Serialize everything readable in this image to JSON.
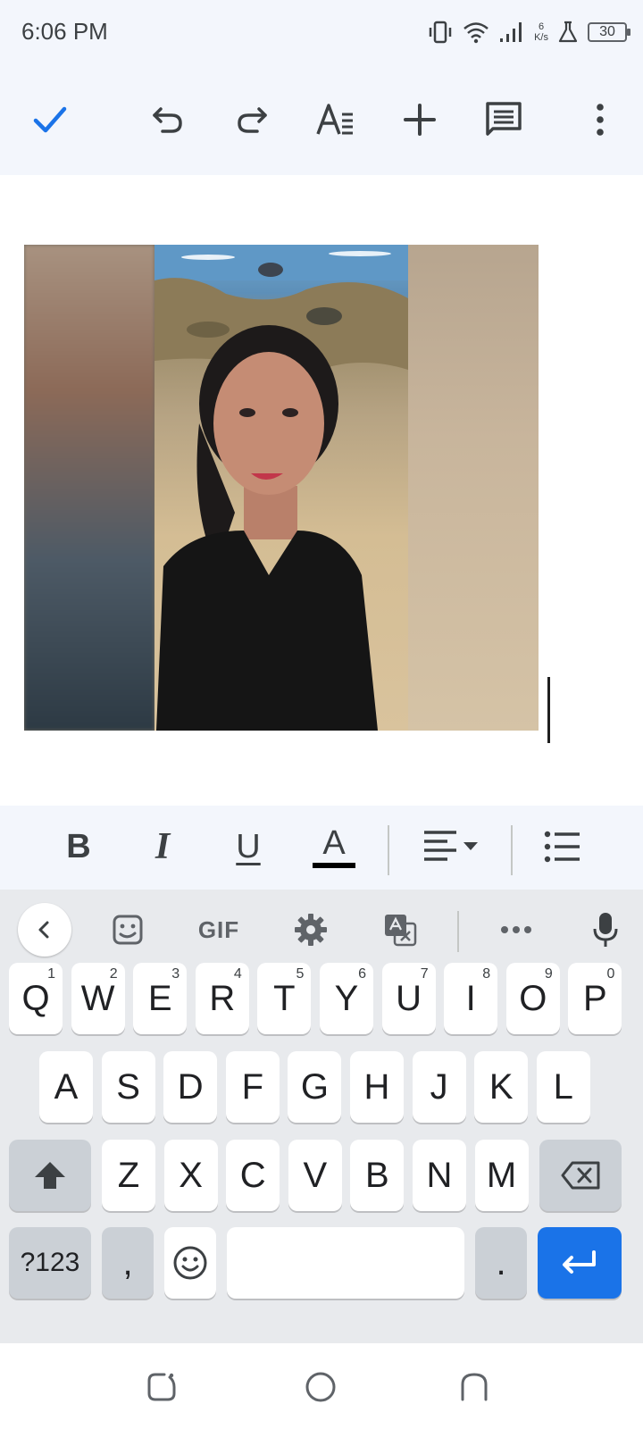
{
  "status_bar": {
    "time": "6:06 PM",
    "net_speed_value": "6",
    "net_speed_unit": "K/s",
    "battery": "30",
    "icons": [
      "vibrate-icon",
      "wifi-icon",
      "signal-icon",
      "flask-icon",
      "battery-icon"
    ]
  },
  "toolbar": {
    "icons": [
      "check-icon",
      "undo-icon",
      "redo-icon",
      "text-format-icon",
      "insert-icon",
      "comment-icon",
      "more-vert-icon"
    ],
    "accent": "#1a73e8"
  },
  "document": {
    "content": "inline image (photo)"
  },
  "format_bar": {
    "bold": "B",
    "italic": "I",
    "underline": "U",
    "text_color": "A",
    "icons": [
      "align-left-icon",
      "bulleted-list-icon"
    ]
  },
  "keyboard": {
    "toolbar": {
      "gif": "GIF",
      "icons": [
        "chevron-left-icon",
        "sticker-icon",
        "settings-icon",
        "translate-icon",
        "more-horiz-icon",
        "mic-icon"
      ]
    },
    "row1": [
      {
        "label": "Q",
        "hint": "1"
      },
      {
        "label": "W",
        "hint": "2"
      },
      {
        "label": "E",
        "hint": "3"
      },
      {
        "label": "R",
        "hint": "4"
      },
      {
        "label": "T",
        "hint": "5"
      },
      {
        "label": "Y",
        "hint": "6"
      },
      {
        "label": "U",
        "hint": "7"
      },
      {
        "label": "I",
        "hint": "8"
      },
      {
        "label": "O",
        "hint": "9"
      },
      {
        "label": "P",
        "hint": "0"
      }
    ],
    "row2": [
      "A",
      "S",
      "D",
      "F",
      "G",
      "H",
      "J",
      "K",
      "L"
    ],
    "row3": [
      "Z",
      "X",
      "C",
      "V",
      "B",
      "N",
      "M"
    ],
    "symbols_key": "?123",
    "comma_key": ",",
    "period_key": ".",
    "enter_color": "#1a73e8"
  },
  "nav_bar": {
    "icons": [
      "recents-icon",
      "home-icon",
      "back-icon"
    ]
  }
}
